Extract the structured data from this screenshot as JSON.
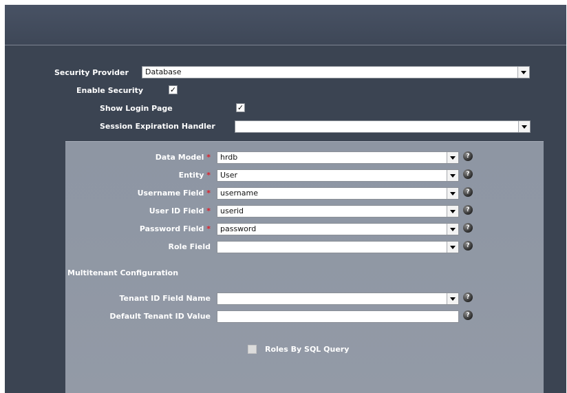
{
  "security": {
    "provider_label": "Security Provider",
    "provider_value": "Database",
    "enable_label": "Enable Security",
    "enable_checked": true,
    "show_login_label": "Show Login Page",
    "show_login_checked": true,
    "session_handler_label": "Session Expiration Handler",
    "session_handler_value": ""
  },
  "database": {
    "required_mark": "*",
    "help_glyph": "?",
    "fields": [
      {
        "label": "Data Model",
        "value": "hrdb",
        "required": true
      },
      {
        "label": "Entity",
        "value": "User",
        "required": true
      },
      {
        "label": "Username Field",
        "value": "username",
        "required": true
      },
      {
        "label": "User ID Field",
        "value": "userid",
        "required": true
      },
      {
        "label": "Password Field",
        "value": "password",
        "required": true
      },
      {
        "label": "Role Field",
        "value": "",
        "required": false
      }
    ]
  },
  "multitenant": {
    "section_title": "Multitenant Configuration",
    "tenant_field_label": "Tenant ID Field Name",
    "tenant_field_value": "",
    "default_tenant_label": "Default Tenant ID Value",
    "default_tenant_value": ""
  },
  "roles_by_sql": {
    "label": "Roles By SQL Query",
    "checked": false
  },
  "colors": {
    "background": "#3b4452",
    "panel": "#8f97a4",
    "required": "#e0202a"
  }
}
